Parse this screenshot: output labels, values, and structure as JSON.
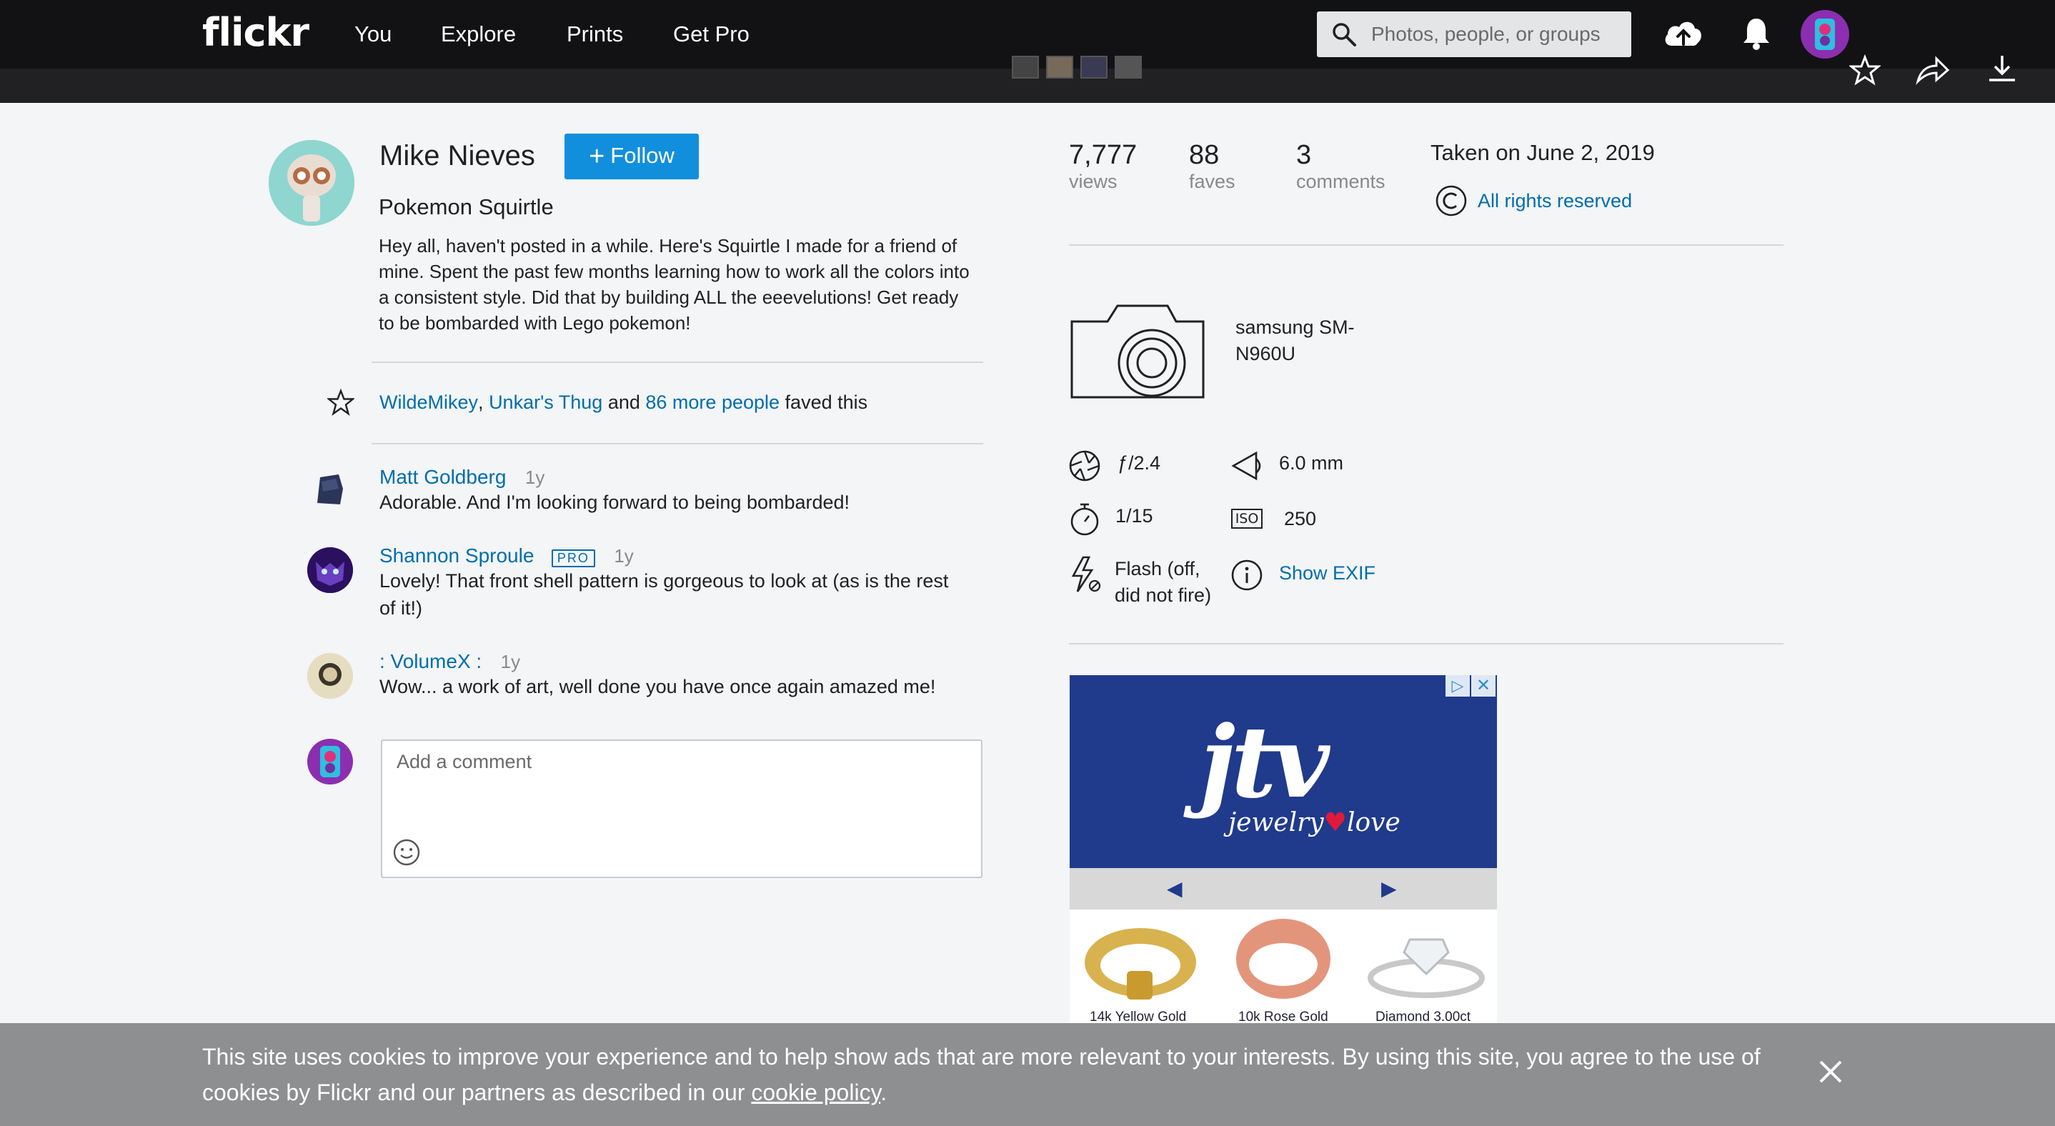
{
  "nav": {
    "logo": "flickr",
    "items": [
      "You",
      "Explore",
      "Prints",
      "Get Pro"
    ],
    "search_placeholder": "Photos, people, or groups"
  },
  "owner": {
    "name": "Mike Nieves",
    "follow_label": "Follow"
  },
  "photo": {
    "title": "Pokemon Squirtle",
    "description": "Hey all, haven't posted in a while. Here's Squirtle I made for a friend of mine. Spent the past few months learning how to work all the colors into a consistent style. Did that by building ALL the eeevelutions! Get ready to be bombarded with Lego pokemon!"
  },
  "faves": {
    "user1": "WildeMikey",
    "sep": ",",
    "user2": "Unkar's Thug",
    "and": "and",
    "more": "86 more people",
    "suffix": "faved this"
  },
  "comments": [
    {
      "name": "Matt Goldberg",
      "time": "1y",
      "text": "Adorable. And I'm looking forward to being bombarded!",
      "pro": ""
    },
    {
      "name": "Shannon Sproule",
      "time": "1y",
      "text": "Lovely! That front shell pattern is gorgeous to look at (as is the rest of it!)",
      "pro": "PRO"
    },
    {
      "name": ": VolumeX :",
      "time": "1y",
      "text": "Wow... a work of art, well done you have once again amazed me!",
      "pro": ""
    }
  ],
  "comment_input": {
    "placeholder": "Add a comment"
  },
  "stats": {
    "views": {
      "value": "7,777",
      "label": "views"
    },
    "faves": {
      "value": "88",
      "label": "faves"
    },
    "comments": {
      "value": "3",
      "label": "comments"
    }
  },
  "taken": "Taken on June 2, 2019",
  "license": "All rights reserved",
  "camera": {
    "line1": "samsung SM-",
    "line2": "N960U"
  },
  "exif": {
    "aperture": "ƒ/2.4",
    "focal": "6.0 mm",
    "shutter": "1/15",
    "iso": "250",
    "iso_label": "ISO",
    "flash_line1": "Flash (off,",
    "flash_line2": "did not fire)",
    "show_exif": "Show EXIF"
  },
  "ad": {
    "brand": "jtv",
    "tagline_a": "jewelry",
    "tagline_b": "love",
    "items": [
      "14k Yellow Gold",
      "10k Rose Gold",
      "Diamond 3.00ct"
    ]
  },
  "cookie": {
    "text": "This site uses cookies to improve your experience and to help show ads that are more relevant to your interests. By using this site, you agree to the use of cookies by Flickr and our partners as described in our",
    "link": "cookie policy",
    "end": "."
  },
  "colors": {
    "accent": "#006dac",
    "follow": "#128fdc",
    "topbar": "#121215"
  }
}
